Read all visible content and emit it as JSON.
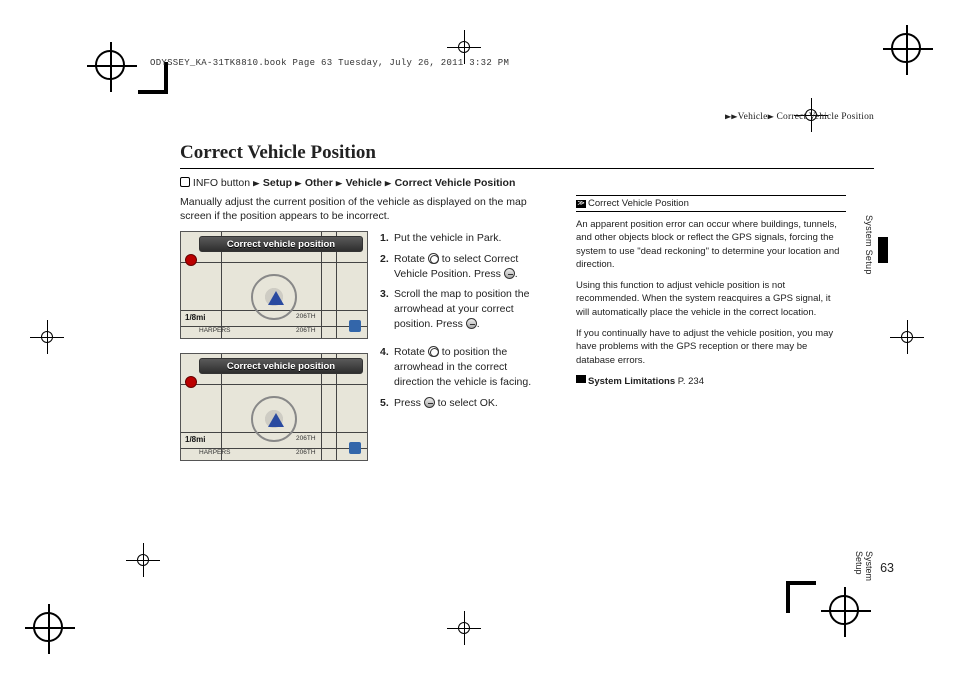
{
  "file_header": "ODYSSEY_KA-31TK8810.book  Page 63  Tuesday, July 26, 2011  3:32 PM",
  "breadcrumb_top": {
    "level1": "Vehicle",
    "level2": "Correct Vehicle Position"
  },
  "title": "Correct Vehicle Position",
  "navpath": {
    "prefix": "INFO button",
    "items": [
      "Setup",
      "Other",
      "Vehicle",
      "Correct Vehicle Position"
    ]
  },
  "intro": "Manually adjust the current position of the vehicle as displayed on the map screen if the position appears to be incorrect.",
  "screenshots": [
    {
      "banner": "Correct vehicle position",
      "scale": "1/8mi",
      "labels": [
        "HARPERS",
        "206TH",
        "206TH"
      ]
    },
    {
      "banner": "Correct vehicle position",
      "scale": "1/8mi",
      "labels": [
        "HARPERS",
        "206TH",
        "206TH"
      ]
    }
  ],
  "steps_a": [
    {
      "n": "1.",
      "text_before": "Put the vehicle in Park.",
      "text_after": ""
    },
    {
      "n": "2.",
      "text_before": "Rotate ",
      "select": "Correct Vehicle Position",
      "text_after": ". Press ",
      "after2": ".",
      "knob": true,
      "enter": true
    },
    {
      "n": "3.",
      "text_before": "Scroll the map to position the arrowhead at your correct position. Press ",
      "text_after": ".",
      "enter_only": true
    }
  ],
  "steps_b": [
    {
      "n": "4.",
      "text_before": "Rotate ",
      "text_mid": " to position the arrowhead in the correct direction the vehicle is facing.",
      "knob": true
    },
    {
      "n": "5.",
      "text_before": "Press ",
      "text_mid": " to select ",
      "ok": "OK",
      "text_after": ".",
      "enter": true
    }
  ],
  "sidebar": {
    "title": "Correct Vehicle Position",
    "paras": [
      "An apparent position error can occur where buildings, tunnels, and other objects block or reflect the GPS signals, forcing the system to use \"dead reckoning\" to determine your location and direction.",
      "Using this function to adjust vehicle position is not recommended. When the system reacquires a GPS signal, it will automatically place the vehicle in the correct location.",
      "If you continually have to adjust the vehicle position, you may have problems with the GPS reception or there may be database errors."
    ],
    "xref_label": "System Limitations",
    "xref_page": "P. 234"
  },
  "tab": "System Setup",
  "page_number": "63"
}
